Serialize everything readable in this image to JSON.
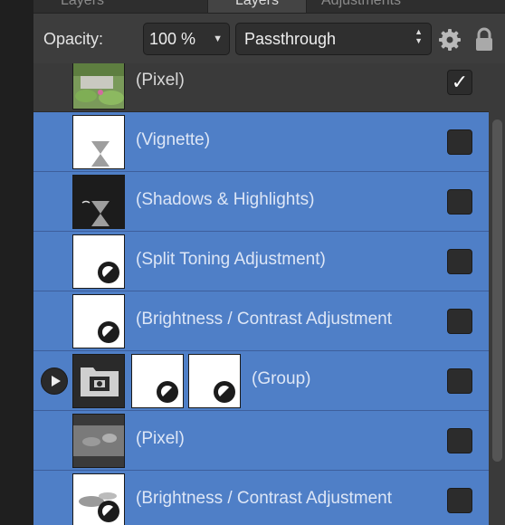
{
  "tabs": [
    {
      "label": "Layers",
      "active": false
    },
    {
      "label": "Layers",
      "active": true
    },
    {
      "label": "Adjustments",
      "active": false
    }
  ],
  "toolbar": {
    "opacity_label": "Opacity:",
    "opacity_value": "100 %",
    "blend_mode": "Passthrough"
  },
  "layers": [
    {
      "name": "(Pixel)",
      "selected": false,
      "checked": true,
      "thumb": "photo-garden"
    },
    {
      "name": "(Vignette)",
      "selected": true,
      "checked": false,
      "thumb": "vignette-hourglass"
    },
    {
      "name": "(Shadows & Highlights)",
      "selected": true,
      "checked": false,
      "thumb": "shadows-hourglass"
    },
    {
      "name": "(Split Toning Adjustment)",
      "selected": true,
      "checked": false,
      "thumb": "adjustment"
    },
    {
      "name": "(Brightness / Contrast Adjustment",
      "selected": true,
      "checked": false,
      "thumb": "adjustment"
    },
    {
      "name": "(Group)",
      "selected": true,
      "checked": false,
      "thumb": "group"
    },
    {
      "name": "(Pixel)",
      "selected": true,
      "checked": false,
      "thumb": "photo-grey"
    },
    {
      "name": "(Brightness / Contrast Adjustment",
      "selected": true,
      "checked": false,
      "thumb": "adjustment-masked"
    }
  ],
  "colors": {
    "selection": "#4f7fc7",
    "panel": "#3a3a3a",
    "control": "#2f2f2f"
  },
  "icons": [
    "gear-icon",
    "lock-icon",
    "expand-arrow-icon",
    "checkbox-icon",
    "adjustment-icon",
    "hourglass-icon",
    "group-folder-icon"
  ]
}
